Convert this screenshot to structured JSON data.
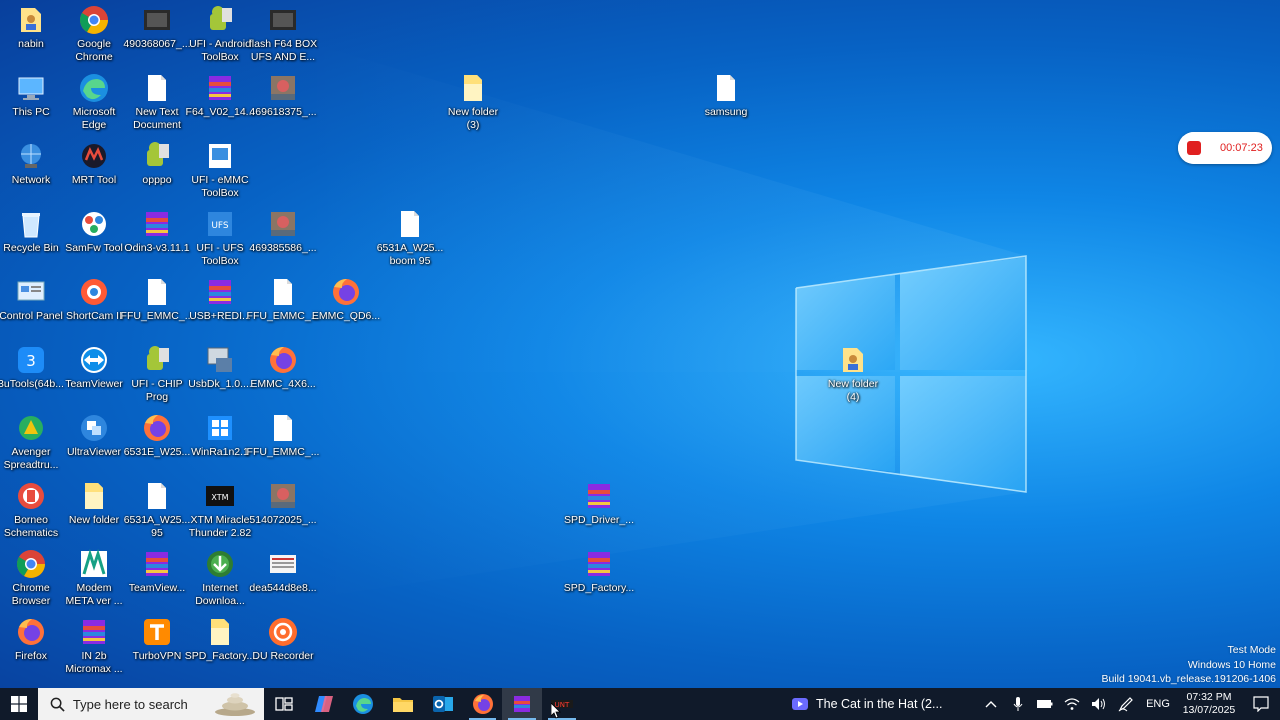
{
  "desktop": {
    "icons": [
      {
        "label": "nabin",
        "kind": "folder-user"
      },
      {
        "label": "Google\nChrome",
        "kind": "chrome"
      },
      {
        "label": "490368067_...",
        "kind": "image-dark"
      },
      {
        "label": "UFI - Android\nToolBox",
        "kind": "android"
      },
      {
        "label": "flash F64 BOX\nUFS AND E...",
        "kind": "image-dark"
      },
      {
        "label": "This PC",
        "kind": "pc"
      },
      {
        "label": "Microsoft\nEdge",
        "kind": "edge"
      },
      {
        "label": "New Text\nDocument",
        "kind": "doc"
      },
      {
        "label": "F64_V02_14...",
        "kind": "rar"
      },
      {
        "label": "469618375_...",
        "kind": "image-photo"
      },
      {
        "label": "New folder\n(3)",
        "kind": "folder-open"
      },
      {
        "label": "samsung",
        "kind": "doc"
      },
      {
        "label": "Network",
        "kind": "network"
      },
      {
        "label": "MRT Tool",
        "kind": "mrt"
      },
      {
        "label": "opppo",
        "kind": "android"
      },
      {
        "label": "UFI - eMMC\nToolBox",
        "kind": "ufi-emmc"
      },
      {
        "label": "Recycle Bin",
        "kind": "recycle"
      },
      {
        "label": "SamFw Tool",
        "kind": "samfw"
      },
      {
        "label": "Odin3-v3.11.1",
        "kind": "rar"
      },
      {
        "label": "UFI - UFS\nToolBox",
        "kind": "ufi-ufs"
      },
      {
        "label": "469385586_...",
        "kind": "image-photo"
      },
      {
        "label": "6531A_W25...\nboom 95",
        "kind": "doc"
      },
      {
        "label": "Control Panel",
        "kind": "control"
      },
      {
        "label": "ShortCam II",
        "kind": "shortcam"
      },
      {
        "label": "FFU_EMMC_...",
        "kind": "doc"
      },
      {
        "label": "USB+REDI...",
        "kind": "rar"
      },
      {
        "label": "FFU_EMMC_...",
        "kind": "doc"
      },
      {
        "label": "EMMC_QD6...",
        "kind": "firefox-doc"
      },
      {
        "label": "3uTools(64b...",
        "kind": "3utools"
      },
      {
        "label": "TeamViewer",
        "kind": "teamviewer"
      },
      {
        "label": "UFI - CHIP\nProg",
        "kind": "android"
      },
      {
        "label": "UsbDk_1.0....",
        "kind": "usbdk"
      },
      {
        "label": "EMMC_4X6...",
        "kind": "firefox-doc"
      },
      {
        "label": "New folder\n(4)",
        "kind": "folder-user"
      },
      {
        "label": "Avenger\nSpreadtru...",
        "kind": "avenger"
      },
      {
        "label": "UltraViewer",
        "kind": "ultraviewer"
      },
      {
        "label": "6531E_W25...",
        "kind": "firefox-doc"
      },
      {
        "label": "WinRa1n2.1",
        "kind": "winrain"
      },
      {
        "label": "FFU_EMMC_...",
        "kind": "doc"
      },
      {
        "label": "Borneo\nSchematics",
        "kind": "borneo"
      },
      {
        "label": "New folder",
        "kind": "folder-open"
      },
      {
        "label": "6531A_W25...\n95",
        "kind": "doc"
      },
      {
        "label": "XTM Miracle\nThunder 2.82",
        "kind": "xtm"
      },
      {
        "label": "514072025_...",
        "kind": "image-photo"
      },
      {
        "label": "SPD_Driver_...",
        "kind": "rar"
      },
      {
        "label": "Chrome\nBrowser",
        "kind": "chrome"
      },
      {
        "label": "Modem\nMETA ver ...",
        "kind": "modem"
      },
      {
        "label": "TeamView...",
        "kind": "rar"
      },
      {
        "label": "Internet\nDownloa...",
        "kind": "idm"
      },
      {
        "label": "dea544d8e8...",
        "kind": "image-sheet"
      },
      {
        "label": "SPD_Factory...",
        "kind": "rar"
      },
      {
        "label": "Firefox",
        "kind": "firefox"
      },
      {
        "label": "IN 2b\nMicromax ...",
        "kind": "rar"
      },
      {
        "label": "TurboVPN",
        "kind": "turbovpn"
      },
      {
        "label": "SPD_Factory...",
        "kind": "folder-open"
      },
      {
        "label": "DU Recorder",
        "kind": "durecorder"
      }
    ]
  },
  "recorder": {
    "time": "00:07:23",
    "icon": "stop-icon"
  },
  "watermark": {
    "line1": "Test Mode",
    "line2": "Windows 10 Home",
    "line3": "Build 19041.vb_release.191206-1406"
  },
  "taskbar": {
    "search_placeholder": "Type here to search",
    "apps": [
      "task-view-icon",
      "copilot-icon",
      "edge-icon",
      "file-explorer-icon",
      "outlook-icon",
      "firefox-icon",
      "winrar-icon",
      "unlock-tool-icon"
    ],
    "media_title": "The Cat in the Hat (2...",
    "language": "ENG",
    "time": "07:32 PM",
    "date": "13/07/2025"
  },
  "colors": {
    "taskbar": "#101a2a",
    "accent": "#76b9ed",
    "record_red": "#e02020"
  }
}
